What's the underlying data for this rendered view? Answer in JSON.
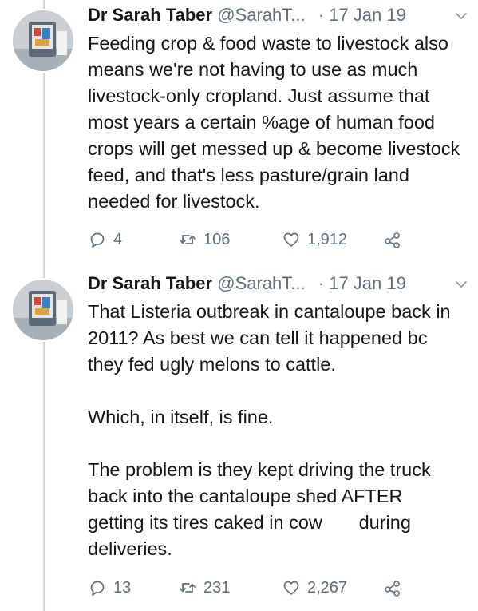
{
  "tweets": [
    {
      "author_name": "Dr Sarah Taber",
      "author_handle": "@SarahT...",
      "date_separator": "·",
      "date": "17 Jan 19",
      "text": "Feeding crop & food waste to livestock also means we're not having to use as much livestock-only cropland. Just assume that most years a certain %age of human food crops will get messed up & become livestock feed, and that's less pasture/grain land needed for livestock.",
      "replies": "4",
      "retweets": "106",
      "likes": "1,912"
    },
    {
      "author_name": "Dr Sarah Taber",
      "author_handle": "@SarahT...",
      "date_separator": "·",
      "date": "17 Jan 19",
      "text_paragraphs": [
        "That Listeria outbreak in cantaloupe back in 2011? As best we can tell it happened bc they fed ugly melons to cattle.",
        "Which, in itself, is fine.",
        "The problem is they kept driving the truck back into the cantaloupe shed AFTER getting its tires caked in cow       during deliveries."
      ],
      "replies": "13",
      "retweets": "231",
      "likes": "2,267"
    }
  ],
  "icons": {
    "reply": "speech-bubble-icon",
    "retweet": "retweet-arrows-icon",
    "like": "heart-icon",
    "share": "share-nodes-icon",
    "caret": "chevron-down-icon"
  },
  "colors": {
    "text": "#14171a",
    "secondary": "#5b7083",
    "thread_line": "#cfd9de",
    "background": "#ffffff"
  }
}
